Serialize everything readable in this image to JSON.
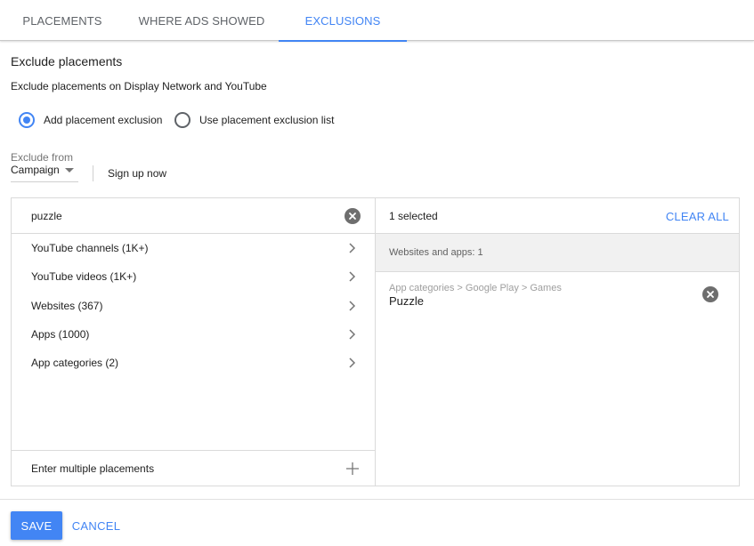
{
  "tabs": [
    {
      "label": "PLACEMENTS",
      "active": false
    },
    {
      "label": "WHERE ADS SHOWED",
      "active": false
    },
    {
      "label": "EXCLUSIONS",
      "active": true
    }
  ],
  "section": {
    "title": "Exclude placements",
    "subtitle": "Exclude placements on Display Network and YouTube"
  },
  "radios": [
    {
      "label": "Add placement exclusion",
      "checked": true
    },
    {
      "label": "Use placement exclusion list",
      "checked": false
    }
  ],
  "exclude_from": {
    "label": "Exclude from",
    "selected": "Campaign"
  },
  "sign_up_label": "Sign up now",
  "search": {
    "value": "puzzle",
    "clear_icon": "clear-circle-icon"
  },
  "categories": [
    {
      "label": "YouTube channels (1K+)"
    },
    {
      "label": "YouTube videos (1K+)"
    },
    {
      "label": "Websites (367)"
    },
    {
      "label": "Apps (1000)"
    },
    {
      "label": "App categories (2)"
    }
  ],
  "multiple_placements_label": "Enter multiple placements",
  "selection": {
    "count_label": "1 selected",
    "clear_all_label": "CLEAR ALL",
    "group_label": "Websites and apps: 1",
    "items": [
      {
        "path": "App categories > Google Play > Games",
        "name": "Puzzle"
      }
    ]
  },
  "footer": {
    "save_label": "SAVE",
    "cancel_label": "CANCEL"
  },
  "colors": {
    "accent": "#4285f4",
    "icon_gray": "#6e6e6e",
    "group_bg": "#f1f1f1"
  }
}
